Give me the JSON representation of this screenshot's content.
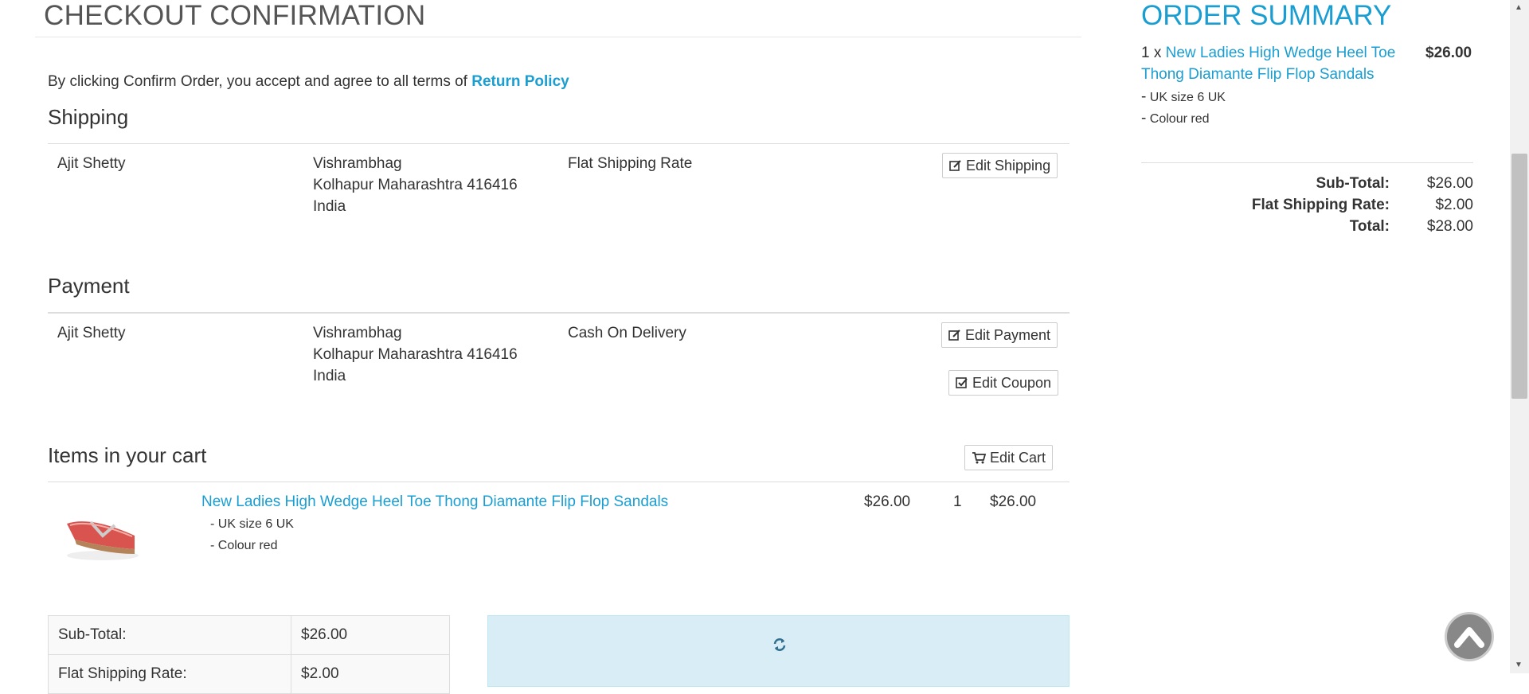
{
  "page": {
    "title": "CHECKOUT CONFIRMATION",
    "terms_text": "By clicking Confirm Order, you accept and agree to all terms of ",
    "terms_link": "Return Policy"
  },
  "shipping": {
    "heading": "Shipping",
    "name": "Ajit Shetty",
    "address_line1": "Vishrambhag",
    "address_line2": "Kolhapur Maharashtra 416416",
    "address_line3": "India",
    "method": "Flat Shipping Rate",
    "edit_label": "Edit Shipping"
  },
  "payment": {
    "heading": "Payment",
    "name": "Ajit Shetty",
    "address_line1": "Vishrambhag",
    "address_line2": "Kolhapur Maharashtra 416416",
    "address_line3": "India",
    "method": "Cash On Delivery",
    "edit_label": "Edit Payment",
    "coupon_label": "Edit Coupon"
  },
  "cart": {
    "heading": "Items in your cart",
    "edit_label": "Edit Cart",
    "item": {
      "name": "New Ladies High Wedge Heel Toe Thong Diamante Flip Flop Sandals",
      "option1": "- UK size 6 UK",
      "option2": "- Colour red",
      "price": "$26.00",
      "qty": "1",
      "total": "$26.00"
    },
    "totals": [
      {
        "label": "Sub-Total:",
        "value": "$26.00"
      },
      {
        "label": "Flat Shipping Rate:",
        "value": "$2.00"
      }
    ]
  },
  "summary": {
    "title": "ORDER SUMMARY",
    "qty_prefix": "1 x ",
    "item_name": "New Ladies High Wedge Heel Toe Thong Diamante Flip Flop Sandals",
    "item_price": "$26.00",
    "option1": "UK size 6 UK",
    "option2": "Colour red",
    "subtotal_label": "Sub-Total:",
    "subtotal_value": "$26.00",
    "shipping_label": "Flat Shipping Rate:",
    "shipping_value": "$2.00",
    "total_label": "Total:",
    "total_value": "$28.00"
  },
  "colors": {
    "accent": "#1a9ed1",
    "info_bg": "#d9edf7"
  },
  "icons": {
    "edit": "edit-icon",
    "coupon": "check-square-icon",
    "cart": "shopping-cart-icon",
    "refresh": "refresh-icon",
    "back_to_top": "chevron-up-icon"
  }
}
